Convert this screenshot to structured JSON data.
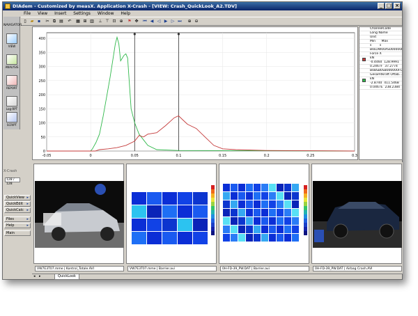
{
  "window": {
    "title": "DIAdem - Customized by measX. Application X-Crash - [VIEW:  Crash_QuickLook_A2.TDV]",
    "controls": [
      "minimize-icon",
      "maximize-icon",
      "close-icon"
    ]
  },
  "menu": [
    "File",
    "View",
    "Insert",
    "Settings",
    "Window",
    "Help"
  ],
  "navigator": {
    "header": "NAVIGATOR",
    "items": [
      {
        "label": "VIEW",
        "icon": "view-icon"
      },
      {
        "label": "ANALYSIS",
        "icon": "analysis-icon"
      },
      {
        "label": "REPORT",
        "icon": "report-icon"
      },
      {
        "label": "Log-RPT",
        "icon": "log-icon"
      },
      {
        "label": "SCRIPT",
        "icon": "script-icon"
      }
    ]
  },
  "left_panel": {
    "title": "X-Crash",
    "page_counter": "128 / 128",
    "buttons": [
      "QuickView",
      "QuickEdit",
      "QuickCalc",
      "Files",
      "Help",
      "Main"
    ]
  },
  "legend": {
    "header": [
      "ChannelCode",
      "Long Name",
      "Unit",
      "Min",
      "Max"
    ],
    "minmax_labels": [
      "Min",
      "Max"
    ],
    "unit_row": [
      "s",
      "s"
    ],
    "channels": [
      {
        "code": "B0LOW00AS000000FOXC",
        "long_name": "Force X",
        "unit": "kN",
        "min": "-0.4460",
        "max": "128.9991",
        "xmin": "0.2467F",
        "xmax": "37.2774",
        "color": "#c43a3a"
      },
      {
        "code": "B0BSB0SB000000FOXD",
        "long_name": "Gesamtkraft Oftab...",
        "unit": "kN",
        "min": "-2.8740",
        "max": "411.5468",
        "xmin": "0.0467E",
        "xmax": "238.2384",
        "color": "#2fb84a"
      }
    ]
  },
  "chart_data": {
    "type": "line",
    "title": "",
    "xlabel": "",
    "ylabel": "",
    "xlim": [
      -0.05,
      0.3
    ],
    "ylim": [
      0,
      420
    ],
    "xticks": [
      "-0.05",
      "0",
      "0.05",
      "0.1",
      "0.15",
      "0.2",
      "0.25",
      "0.3"
    ],
    "yticks": [
      "0",
      "50",
      "100",
      "150",
      "200",
      "250",
      "300",
      "350",
      "400"
    ],
    "cursors_x": [
      0.05,
      0.1
    ],
    "series": [
      {
        "name": "Gesamtkraft Oftab...",
        "color": "#2fb84a",
        "points": [
          [
            -0.05,
            0
          ],
          [
            0,
            0
          ],
          [
            0.002,
            8
          ],
          [
            0.006,
            30
          ],
          [
            0.01,
            60
          ],
          [
            0.014,
            120
          ],
          [
            0.018,
            190
          ],
          [
            0.022,
            260
          ],
          [
            0.026,
            340
          ],
          [
            0.028,
            380
          ],
          [
            0.03,
            404
          ],
          [
            0.032,
            380
          ],
          [
            0.034,
            320
          ],
          [
            0.036,
            330
          ],
          [
            0.038,
            340
          ],
          [
            0.04,
            345
          ],
          [
            0.042,
            330
          ],
          [
            0.044,
            240
          ],
          [
            0.046,
            150
          ],
          [
            0.05,
            100
          ],
          [
            0.055,
            60
          ],
          [
            0.06,
            40
          ],
          [
            0.065,
            20
          ],
          [
            0.075,
            5
          ],
          [
            0.1,
            2
          ],
          [
            0.3,
            0
          ]
        ]
      },
      {
        "name": "Force X",
        "color": "#c43a3a",
        "points": [
          [
            -0.05,
            0
          ],
          [
            0.005,
            0
          ],
          [
            0.01,
            5
          ],
          [
            0.02,
            8
          ],
          [
            0.03,
            12
          ],
          [
            0.04,
            20
          ],
          [
            0.05,
            35
          ],
          [
            0.055,
            55
          ],
          [
            0.06,
            50
          ],
          [
            0.065,
            60
          ],
          [
            0.075,
            65
          ],
          [
            0.085,
            90
          ],
          [
            0.095,
            118
          ],
          [
            0.1,
            125
          ],
          [
            0.105,
            110
          ],
          [
            0.11,
            95
          ],
          [
            0.12,
            80
          ],
          [
            0.13,
            50
          ],
          [
            0.14,
            20
          ],
          [
            0.15,
            8
          ],
          [
            0.165,
            5
          ],
          [
            0.2,
            2
          ],
          [
            0.3,
            0
          ]
        ]
      }
    ]
  },
  "thumbnails": [
    {
      "caption": "VW7E3T07.mme | Kontrol_Totale.AVI",
      "kind": "crash-photo"
    },
    {
      "caption": "VW7E3T07.mme | Barrier.avi",
      "kind": "heatmap-3d"
    },
    {
      "caption": "0H-FD-39_PW.DAT | Barrier.avi",
      "kind": "heatmap"
    },
    {
      "caption": "0H-FD-39_PW.DAT | Airbag Crash.AVI",
      "kind": "crash-photo"
    }
  ],
  "tab": "QuickLook",
  "colors": {
    "green": "#2fb84a",
    "red": "#c43a3a",
    "title": "#0a246a"
  }
}
